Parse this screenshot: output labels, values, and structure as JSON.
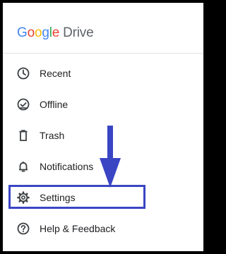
{
  "brand": {
    "google_letters": [
      {
        "char": "G",
        "color": "#4285F4"
      },
      {
        "char": "o",
        "color": "#EA4335"
      },
      {
        "char": "o",
        "color": "#FBBC05"
      },
      {
        "char": "g",
        "color": "#4285F4"
      },
      {
        "char": "l",
        "color": "#34A853"
      },
      {
        "char": "e",
        "color": "#EA4335"
      }
    ],
    "product": "Drive"
  },
  "menu": {
    "items": [
      {
        "label": "Recent",
        "icon": "clock-icon"
      },
      {
        "label": "Offline",
        "icon": "offline-check-icon"
      },
      {
        "label": "Trash",
        "icon": "trash-icon"
      },
      {
        "label": "Notifications",
        "icon": "bell-icon"
      },
      {
        "label": "Settings",
        "icon": "gear-icon"
      },
      {
        "label": "Help & Feedback",
        "icon": "help-icon"
      }
    ]
  },
  "annotation": {
    "highlight_color": "#3a45c4",
    "arrow_color": "#3a45c4",
    "target": "Settings"
  },
  "colors": {
    "icon": "#3c4043",
    "text": "#202124"
  }
}
